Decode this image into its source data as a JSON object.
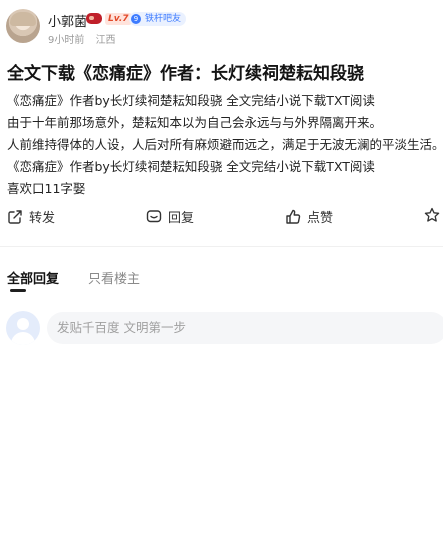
{
  "post": {
    "author": {
      "name": "小郭菌",
      "level": "Lv.7",
      "fan_badge_num": "9",
      "fan_badge": "铁杆吧友",
      "time": "9小时前",
      "location": "江西"
    },
    "title": "全文下载《恋痛症》作者：长灯续祠楚耘知段骁",
    "lines": [
      "《恋痛症》作者by长灯续祠楚耘知段骁 全文完结小说下载TXT阅读",
      "由于十年前那场意外，楚耘知本以为自己会永远与与外界隔离开来。",
      "人前维持得体的人设，人后对所有麻烦避而远之，满足于无波无澜的平淡生活。",
      "《恋痛症》作者by长灯续祠楚耘知段骁 全文完结小说下载TXT阅读",
      "喜欢口11字娶"
    ]
  },
  "actions": {
    "share": "转发",
    "reply": "回复",
    "like": "点赞"
  },
  "tabs": {
    "all_replies": "全部回复",
    "op_only": "只看楼主"
  },
  "comment_input": {
    "placeholder": "发贴千百度 文明第一步"
  }
}
